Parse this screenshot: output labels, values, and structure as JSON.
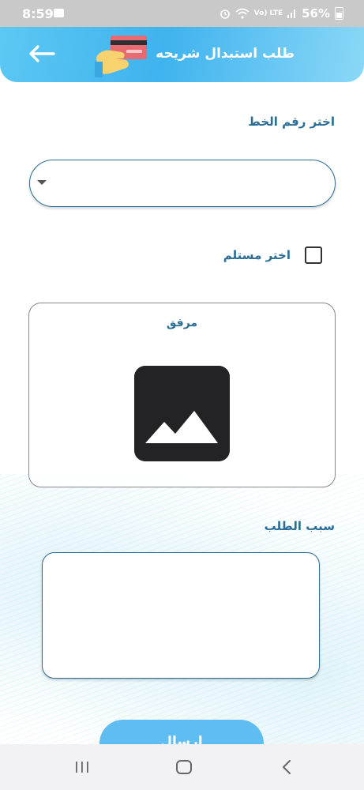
{
  "status_bar": {
    "time": "8:59",
    "network_label": "Vo) LTE",
    "battery": "56%"
  },
  "header": {
    "title": "طلب استبدال شريحه",
    "back_icon": "arrow-left-icon",
    "image_icon": "hand-card-icon"
  },
  "form": {
    "line_label": "اختر رقم الخط",
    "line_value": "",
    "receiver_label": "اختر مستلم",
    "receiver_checked": false,
    "attachment_label": "مرفق",
    "reason_label": "سبب الطلب",
    "reason_value": "",
    "send_label": "ارسال"
  },
  "nav": {
    "recents_icon": "recents-icon",
    "home_icon": "home-icon",
    "back_icon": "chevron-left-icon"
  },
  "colors": {
    "accent": "#3fb3ee",
    "label": "#2a6d96",
    "button": "#5fbdf2"
  }
}
